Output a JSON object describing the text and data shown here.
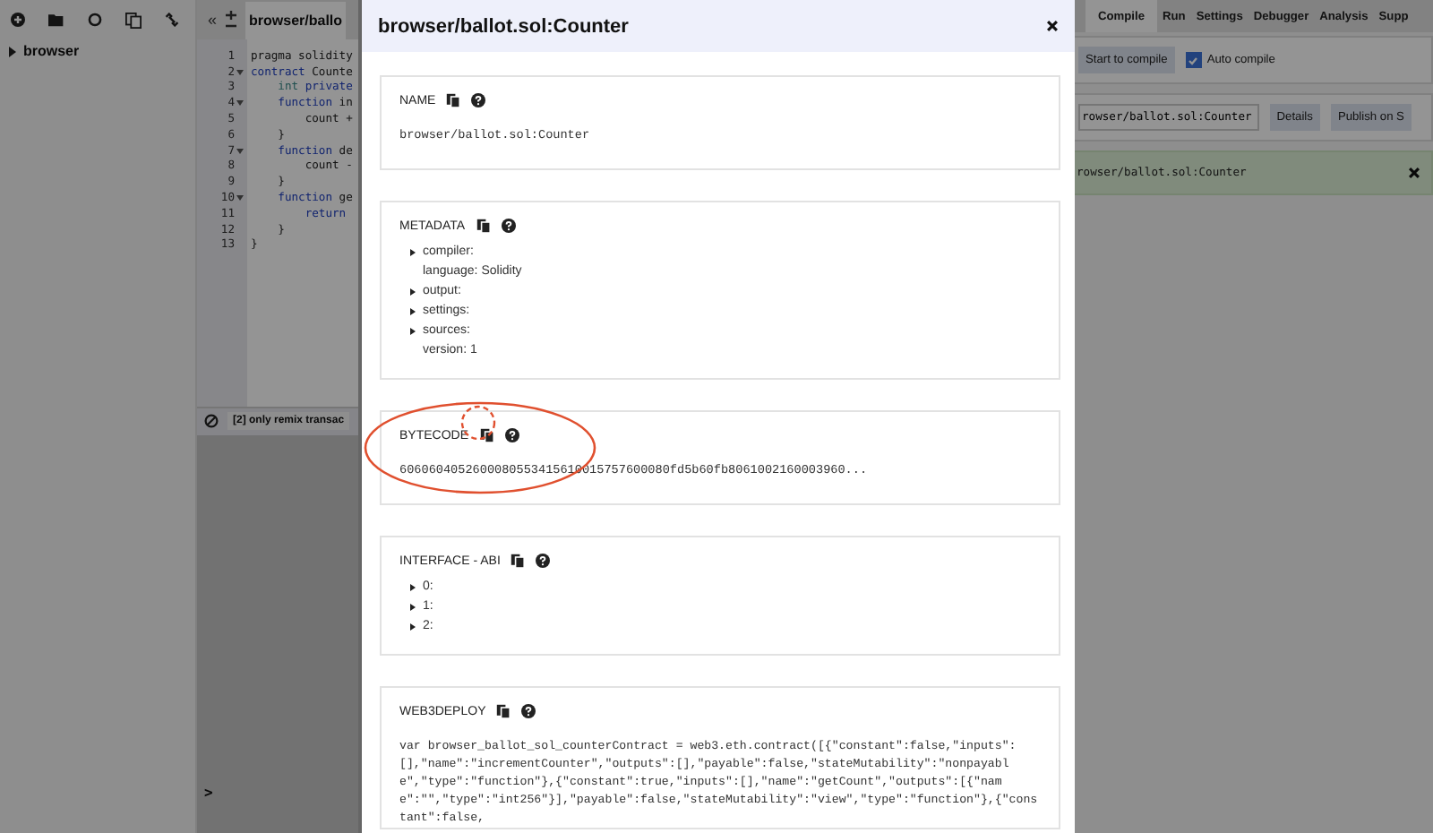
{
  "file_panel": {
    "tree": [
      {
        "label": "browser",
        "expanded": false
      }
    ]
  },
  "editor": {
    "collapse": "«",
    "tabs": [
      {
        "label": "browser/ballo",
        "selected": true
      }
    ],
    "lines": [
      {
        "number": "1",
        "foldable": false,
        "tokens": [
          {
            "text": "pragma solidity",
            "kind": "plain"
          }
        ]
      },
      {
        "number": "2",
        "foldable": true,
        "tokens": [
          {
            "text": "contract",
            "kind": "keyword"
          },
          {
            "text": " Counte",
            "kind": "plain"
          }
        ]
      },
      {
        "number": "3",
        "foldable": false,
        "tokens": [
          {
            "text": "    int",
            "kind": "type"
          },
          {
            "text": " private",
            "kind": "keyword"
          }
        ]
      },
      {
        "number": "4",
        "foldable": true,
        "tokens": [
          {
            "text": "    function",
            "kind": "keyword"
          },
          {
            "text": " in",
            "kind": "plain"
          }
        ]
      },
      {
        "number": "5",
        "foldable": false,
        "tokens": [
          {
            "text": "        count +",
            "kind": "plain"
          }
        ]
      },
      {
        "number": "6",
        "foldable": false,
        "tokens": [
          {
            "text": "    }",
            "kind": "plain"
          }
        ]
      },
      {
        "number": "7",
        "foldable": true,
        "tokens": [
          {
            "text": "    function",
            "kind": "keyword"
          },
          {
            "text": " de",
            "kind": "plain"
          }
        ]
      },
      {
        "number": "8",
        "foldable": false,
        "tokens": [
          {
            "text": "        count -",
            "kind": "plain"
          }
        ]
      },
      {
        "number": "9",
        "foldable": false,
        "tokens": [
          {
            "text": "    }",
            "kind": "plain"
          }
        ]
      },
      {
        "number": "10",
        "foldable": true,
        "tokens": [
          {
            "text": "    function",
            "kind": "keyword"
          },
          {
            "text": " ge",
            "kind": "plain"
          }
        ]
      },
      {
        "number": "11",
        "foldable": false,
        "tokens": [
          {
            "text": "        return",
            "kind": "keyword"
          }
        ]
      },
      {
        "number": "12",
        "foldable": false,
        "tokens": [
          {
            "text": "    }",
            "kind": "plain"
          }
        ]
      },
      {
        "number": "13",
        "foldable": false,
        "tokens": [
          {
            "text": "}",
            "kind": "plain"
          }
        ]
      }
    ]
  },
  "terminal": {
    "filter": "[2] only remix transac",
    "prompt": ">"
  },
  "right_panel": {
    "tabs": [
      {
        "label": "Compile",
        "selected": true
      },
      {
        "label": "Run",
        "selected": false
      },
      {
        "label": "Settings",
        "selected": false
      },
      {
        "label": "Debugger",
        "selected": false
      },
      {
        "label": "Analysis",
        "selected": false
      },
      {
        "label": "Supp",
        "selected": false
      }
    ],
    "compile_button": "Start to compile",
    "auto_compile": {
      "label": "Auto compile",
      "checked": true
    },
    "contract_select": "rowser/ballot.sol:Counter",
    "buttons": [
      "Details",
      "Publish on S"
    ],
    "alert": "rowser/ballot.sol:Counter"
  },
  "modal": {
    "title": "browser/ballot.sol:Counter",
    "sections": [
      {
        "label": "NAME",
        "kind": "text",
        "highlighted": false,
        "value": "browser/ballot.sol:Counter"
      },
      {
        "label": "METADATA",
        "kind": "tree",
        "highlighted": false,
        "items": [
          {
            "label": "compiler:",
            "expandable": true
          },
          {
            "label": "language: Solidity",
            "expandable": false
          },
          {
            "label": "output:",
            "expandable": true
          },
          {
            "label": "settings:",
            "expandable": true
          },
          {
            "label": "sources:",
            "expandable": true
          },
          {
            "label": "version: 1",
            "expandable": false
          }
        ]
      },
      {
        "label": "BYTECODE",
        "kind": "text",
        "highlighted": true,
        "value": "6060604052600080553415610015757600080fd5b60fb8061002160003960..."
      },
      {
        "label": "INTERFACE - ABI",
        "kind": "tree",
        "highlighted": false,
        "items": [
          {
            "label": "0:",
            "expandable": true
          },
          {
            "label": "1:",
            "expandable": true
          },
          {
            "label": "2:",
            "expandable": true
          }
        ]
      },
      {
        "label": "WEB3DEPLOY",
        "kind": "code",
        "highlighted": false,
        "value": "var browser_ballot_sol_counterContract = web3.eth.contract([{\"constant\":false,\"inputs\":[],\"name\":\"incrementCounter\",\"outputs\":[],\"payable\":false,\"stateMutability\":\"nonpayable\",\"type\":\"function\"},{\"constant\":true,\"inputs\":[],\"name\":\"getCount\",\"outputs\":[{\"name\":\"\",\"type\":\"int256\"}],\"payable\":false,\"stateMutability\":\"view\",\"type\":\"function\"},{\"constant\":false,"
      }
    ]
  }
}
